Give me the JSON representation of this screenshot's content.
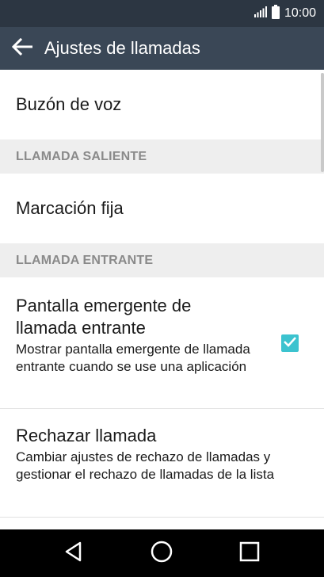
{
  "status_bar": {
    "time": "10:00"
  },
  "app_bar": {
    "title": "Ajustes de llamadas"
  },
  "items": {
    "voicemail": {
      "title": "Buzón de voz"
    },
    "fixed_dialing": {
      "title": "Marcación fija"
    },
    "incoming_popup": {
      "title": "Pantalla emergente de llamada entrante",
      "subtitle": "Mostrar pantalla emergente de llamada entrante cuando se use una aplicación",
      "checked": true
    },
    "reject_call": {
      "title": "Rechazar llamada",
      "subtitle": "Cambiar ajustes de rechazo de llamadas y gestionar el rechazo de llamadas de la lista"
    }
  },
  "sections": {
    "outgoing": "LLAMADA SALIENTE",
    "incoming": "LLAMADA ENTRANTE"
  },
  "colors": {
    "status_bar": "#2c3642",
    "app_bar": "#3a4756",
    "section_header_bg": "#eeeeee",
    "checkbox_accent": "#3cc3cf",
    "nav_bar": "#000000"
  },
  "icons": {
    "signal": "signal-icon",
    "battery": "battery-icon",
    "back": "back-arrow-icon",
    "nav_back": "nav-back-icon",
    "nav_home": "nav-home-icon",
    "nav_recents": "nav-recents-icon",
    "check": "check-icon"
  }
}
